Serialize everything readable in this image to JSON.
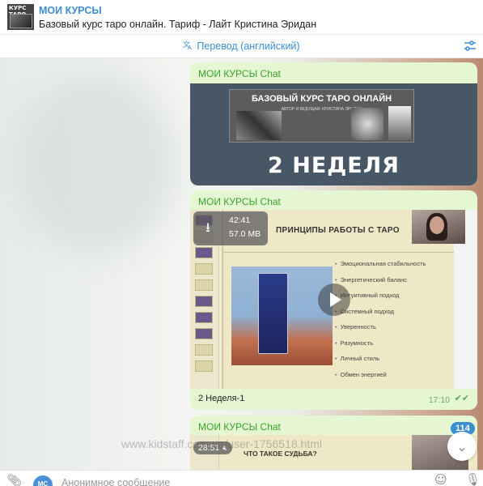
{
  "header": {
    "avatar_text": "КУРС ТАРО",
    "title": "МОИ КУРСЫ",
    "subtitle": "Базовый курс таро онлайн. Тариф - Лайт Кристина Эридан"
  },
  "translate_bar": {
    "icon": "translate-icon",
    "label": "Перевод (английский)"
  },
  "messages": [
    {
      "sender": "МОИ КУРСЫ Chat",
      "banner_title": "БАЗОВЫЙ КУРС ТАРО ОНЛАЙН",
      "banner_subtitle": "АВТОР И ВЕДУЩАЯ: КРИСТИНА ЭРИДАН",
      "overlay_title": "2 НЕДЕЛЯ"
    },
    {
      "sender": "МОИ КУРСЫ Chat",
      "duration": "42:41",
      "size": "57.0 MB",
      "slide_title": "ПРИНЦИПЫ РАБОТЫ С ТАРО",
      "bullets": [
        "Эмоциональная стабильность",
        "Энергетический баланс",
        "Интуитивный подход",
        "Системный подход",
        "Уверенность",
        "Разумность",
        "Личный стиль",
        "Обмен энергией"
      ],
      "caption": "2 Неделя-1",
      "time": "17:10"
    },
    {
      "sender": "МОИ КУРСЫ Chat",
      "duration": "28:51",
      "slide_title": "ЧТО ТАКОЕ СУДЬБА?"
    }
  ],
  "unread_badge": "114",
  "watermark": "www.kidstaff.com.ua/user-1756518.html",
  "composer": {
    "avatar_initials": "MC",
    "placeholder": "Анонимное сообщение"
  },
  "colors": {
    "accent": "#3a8fd1",
    "sender": "#3aa228",
    "bubble": "#e4f7d2"
  }
}
